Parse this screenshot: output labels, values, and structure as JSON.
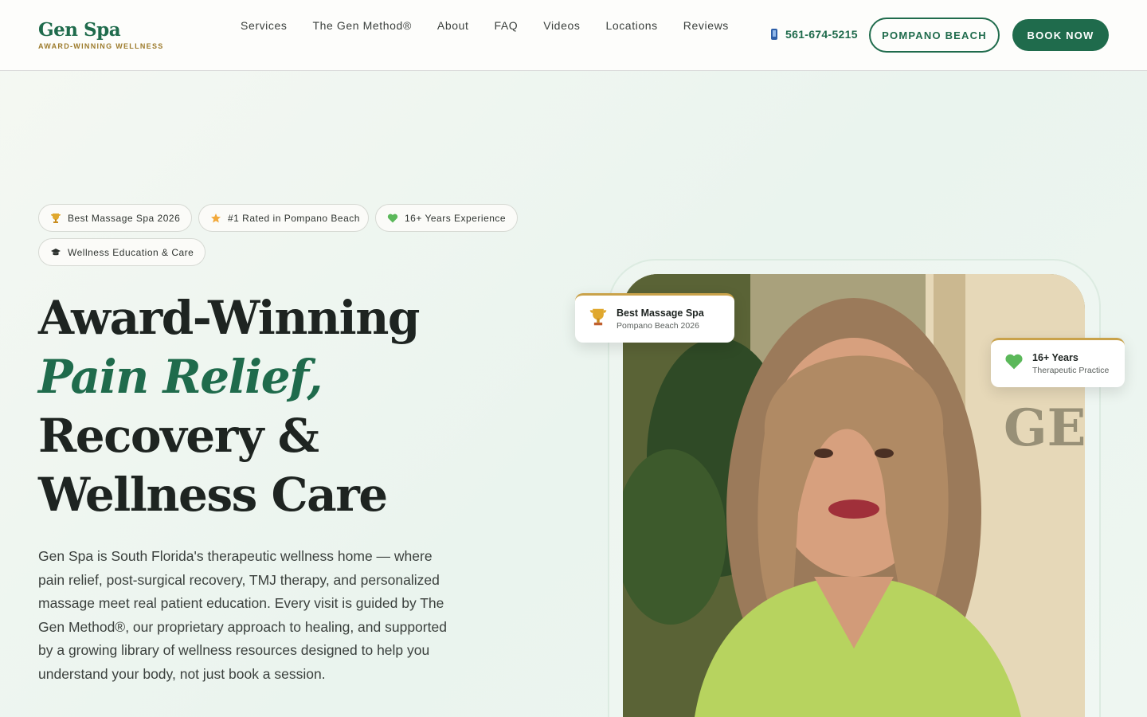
{
  "header": {
    "logo_name": "Gen Spa",
    "logo_tagline": "AWARD-WINNING WELLNESS",
    "nav": [
      "Services",
      "The Gen Method®",
      "About",
      "FAQ",
      "Videos",
      "Locations",
      "Reviews"
    ],
    "phone": "561-674-5215",
    "location_button": "POMPANO BEACH",
    "book_button": "BOOK NOW"
  },
  "badges": [
    {
      "icon": "trophy-icon",
      "label": "Best Massage Spa 2026"
    },
    {
      "icon": "star-icon",
      "label": "#1 Rated in Pompano Beach"
    },
    {
      "icon": "heart-icon",
      "label": "16+ Years Experience"
    },
    {
      "icon": "graduation-cap-icon",
      "label": "Wellness Education & Care"
    }
  ],
  "hero": {
    "title_line1": "Award-Winning",
    "title_line2": "Pain Relief,",
    "title_line3": "Recovery &",
    "title_line4": "Wellness Care",
    "description": "Gen Spa is South Florida's therapeutic wellness home — where pain relief, post-surgical recovery, TMJ therapy, and personalized massage meet real patient education. Every visit is guided by The Gen Method®, our proprietary approach to healing, and supported by a growing library of wellness resources designed to help you understand your body, not just book a session."
  },
  "cards": {
    "award": {
      "title": "Best Massage Spa",
      "subtitle": "Pompano Beach 2026"
    },
    "experience": {
      "title": "16+ Years",
      "subtitle": "Therapeutic Practice"
    }
  },
  "colors": {
    "brand_green": "#1f6b4c",
    "gold": "#c9a24a",
    "text_dark": "#1e2421"
  }
}
